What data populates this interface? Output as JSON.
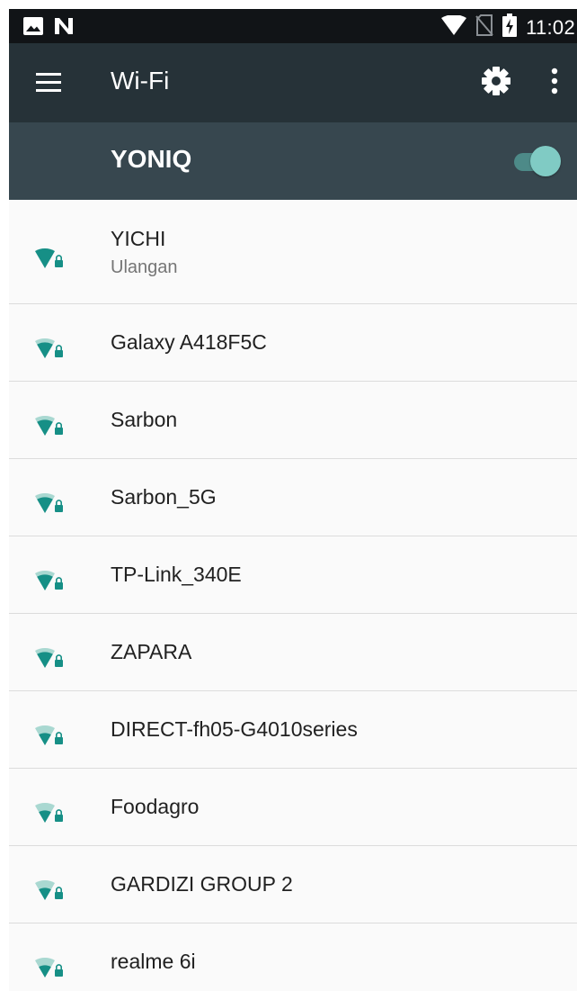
{
  "status_bar": {
    "time": "11:02",
    "left_icons": [
      "image-icon",
      "n-icon"
    ],
    "right_icons": [
      "wifi-signal-icon",
      "no-sim-icon",
      "battery-charging-icon"
    ]
  },
  "app_bar": {
    "title": "Wi-Fi",
    "menu_icon": "hamburger-menu-icon",
    "settings_icon": "gear-icon",
    "overflow_icon": "more-vert-icon"
  },
  "master_switch": {
    "label": "YONIQ",
    "state": "on"
  },
  "colors": {
    "status_bar": "#111417",
    "app_bar": "#263238",
    "switch_bar": "#37474f",
    "accent": "#009688",
    "wifi_full": "#168f86",
    "wifi_partial": "#a9d8d1",
    "toggle_thumb": "#80cbc4"
  },
  "networks": [
    {
      "name": "YICHI",
      "status": "Ulangan",
      "locked": true,
      "signal": 4
    },
    {
      "name": "Galaxy A418F5C",
      "locked": true,
      "signal": 3
    },
    {
      "name": "Sarbon",
      "locked": true,
      "signal": 3
    },
    {
      "name": "Sarbon_5G",
      "locked": true,
      "signal": 3
    },
    {
      "name": "TP-Link_340E",
      "locked": true,
      "signal": 3
    },
    {
      "name": "ZAPARA",
      "locked": true,
      "signal": 3
    },
    {
      "name": "DIRECT-fh05-G4010series",
      "locked": true,
      "signal": 2
    },
    {
      "name": "Foodagro",
      "locked": true,
      "signal": 2
    },
    {
      "name": "GARDIZI GROUP 2",
      "locked": true,
      "signal": 2
    },
    {
      "name": "realme 6i",
      "locked": true,
      "signal": 2
    }
  ]
}
